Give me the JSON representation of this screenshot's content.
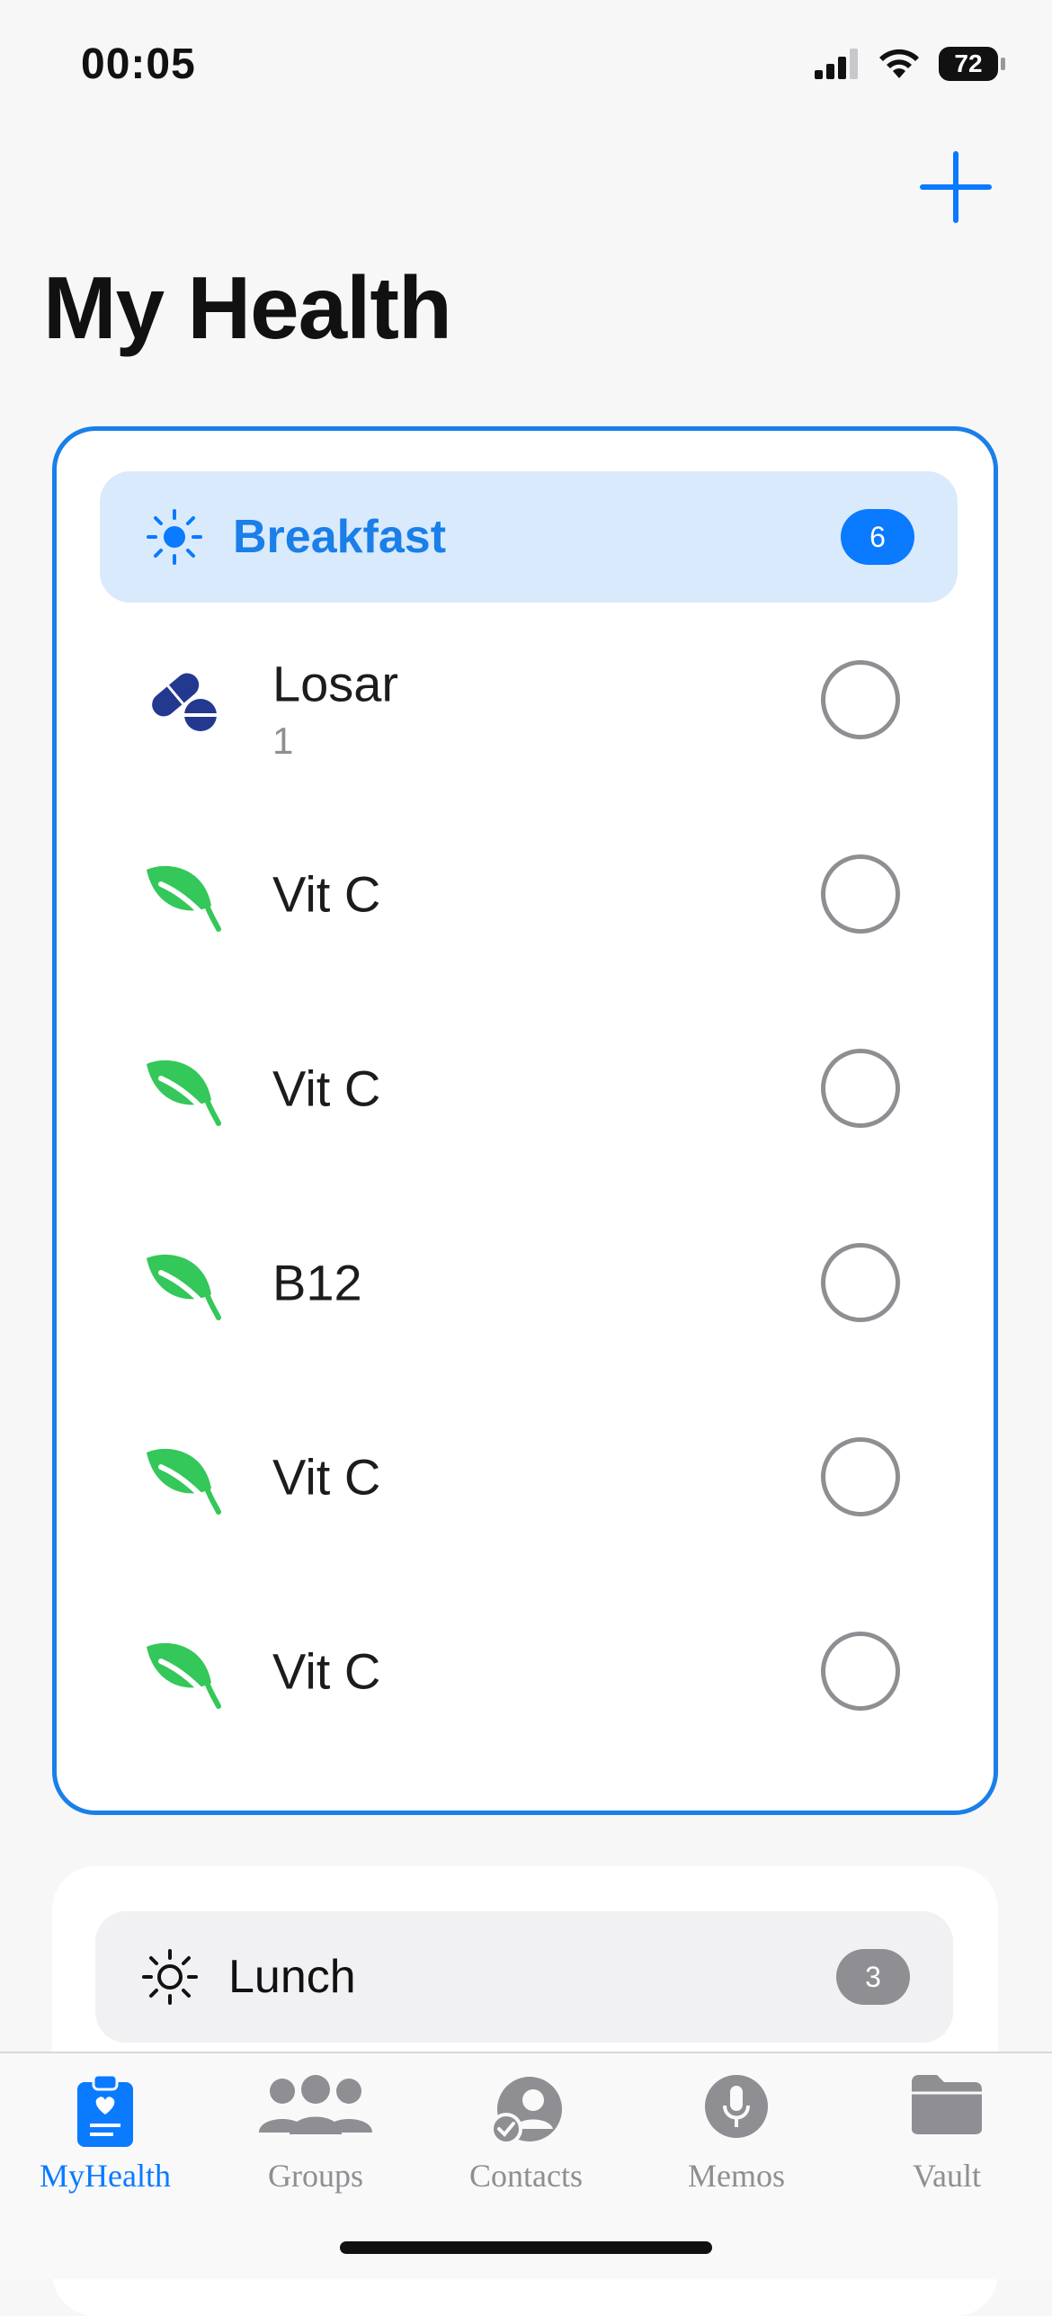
{
  "status_bar": {
    "time": "00:05",
    "battery": "72"
  },
  "header": {
    "title": "My Health",
    "add_icon": "plus-icon"
  },
  "colors": {
    "accent": "#0a7aff",
    "leaf": "#34c759",
    "pill": "#23388f",
    "inactive": "#8e8e93"
  },
  "meals": [
    {
      "name": "Breakfast",
      "icon": "sun-icon",
      "count": "6",
      "items": [
        {
          "name": "Losar",
          "dose": "1",
          "icon": "pill-icon"
        },
        {
          "name": "Vit C",
          "icon": "leaf-icon"
        },
        {
          "name": "Vit C",
          "icon": "leaf-icon"
        },
        {
          "name": "B12",
          "icon": "leaf-icon"
        },
        {
          "name": "Vit C",
          "icon": "leaf-icon"
        },
        {
          "name": "Vit C",
          "icon": "leaf-icon"
        }
      ]
    },
    {
      "name": "Lunch",
      "icon": "sun-icon",
      "count": "3"
    }
  ],
  "tabs": [
    {
      "label": "MyHealth",
      "icon": "clipboard-heart-icon",
      "active": true
    },
    {
      "label": "Groups",
      "icon": "people-icon"
    },
    {
      "label": "Contacts",
      "icon": "contact-check-icon"
    },
    {
      "label": "Memos",
      "icon": "mic-icon"
    },
    {
      "label": "Vault",
      "icon": "folder-icon"
    }
  ]
}
